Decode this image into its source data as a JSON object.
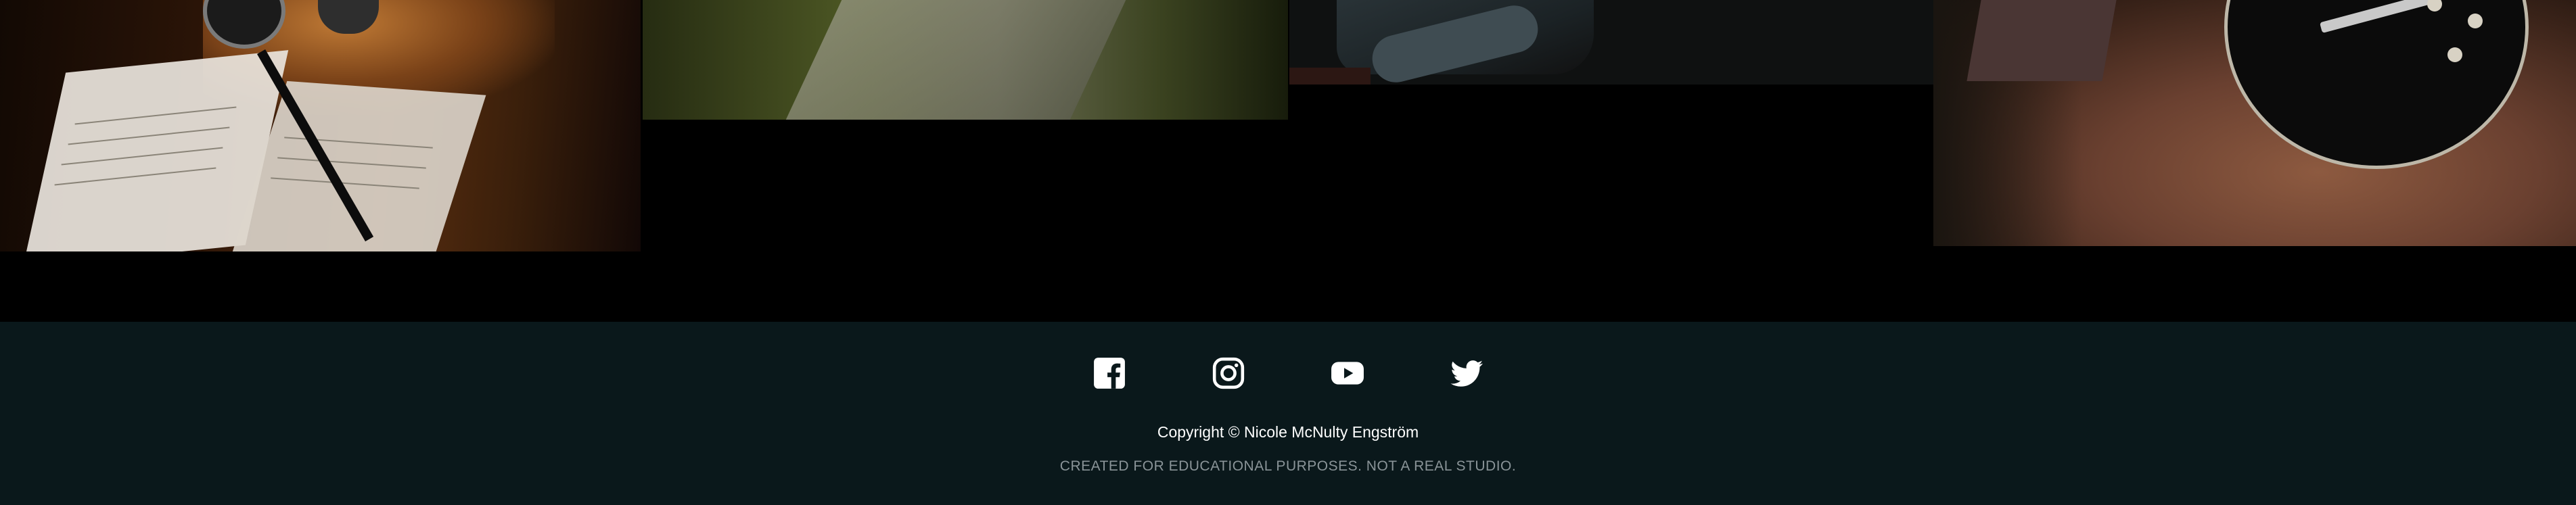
{
  "gallery": {
    "images": [
      {
        "subject": "microphone and sheet music"
      },
      {
        "subject": "forest path"
      },
      {
        "subject": "dark couch"
      },
      {
        "subject": "black electric guitar on leather"
      }
    ]
  },
  "footer": {
    "background_color": "#0a181b",
    "social_links": [
      {
        "name": "facebook-icon"
      },
      {
        "name": "instagram-icon"
      },
      {
        "name": "youtube-icon"
      },
      {
        "name": "twitter-icon"
      }
    ],
    "copyright": "Copyright © Nicole McNulty Engström",
    "credit": "CREATED FOR EDUCATIONAL PURPOSES. NOT A REAL STUDIO."
  }
}
